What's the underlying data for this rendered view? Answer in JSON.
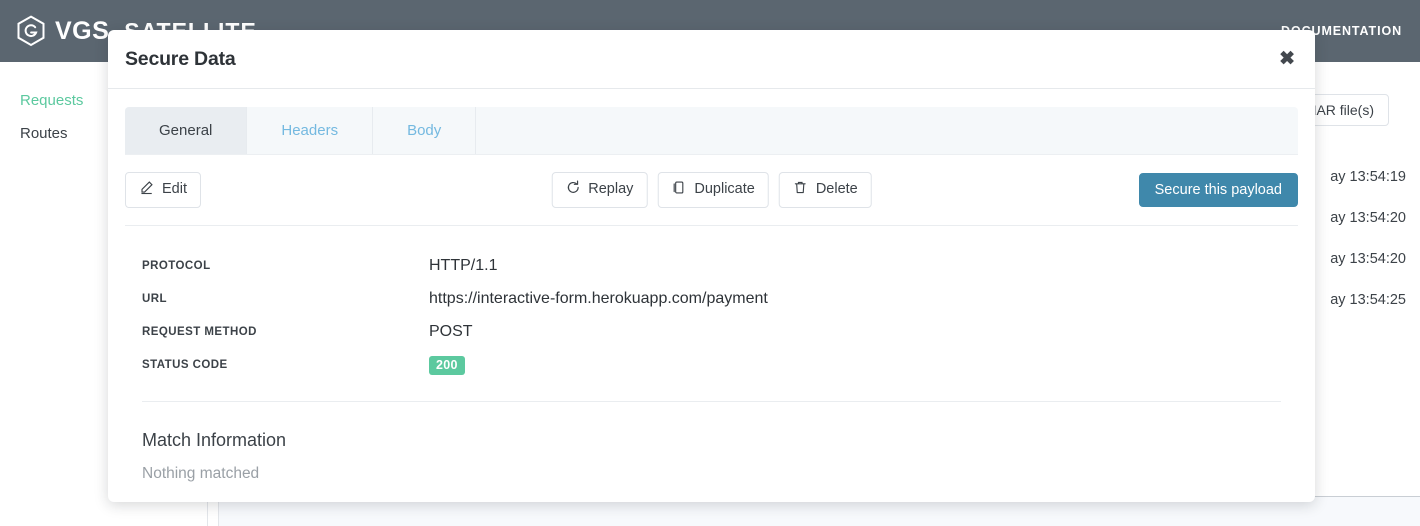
{
  "topbar": {
    "brand_mark": "vgs-hex-logo",
    "brand_name": "VGS",
    "product_name": "SATELLITE",
    "nav": [
      {
        "label": "DOCUMENTATION",
        "name": "documentation"
      }
    ]
  },
  "sidebar": {
    "items": [
      {
        "label": "Requests",
        "active": true
      },
      {
        "label": "Routes",
        "active": false
      }
    ]
  },
  "content": {
    "toolbar": {
      "har_button_label": "HAR file(s)"
    },
    "request_rows": [
      {
        "timestamp": "ay 13:54:19"
      },
      {
        "timestamp": "ay 13:54:20"
      },
      {
        "timestamp": "ay 13:54:20"
      },
      {
        "timestamp": "ay 13:54:25"
      }
    ]
  },
  "modal": {
    "title": "Secure Data",
    "close_label": "✖",
    "tabs": [
      {
        "label": "General",
        "active": true
      },
      {
        "label": "Headers",
        "active": false
      },
      {
        "label": "Body",
        "active": false
      }
    ],
    "actions": {
      "edit_label": "Edit",
      "replay_label": "Replay",
      "duplicate_label": "Duplicate",
      "delete_label": "Delete",
      "primary_label": "Secure this payload"
    },
    "details": [
      {
        "label": "PROTOCOL",
        "value": "HTTP/1.1",
        "type": "text"
      },
      {
        "label": "URL",
        "value": "https://interactive-form.herokuapp.com/payment",
        "type": "text"
      },
      {
        "label": "REQUEST METHOD",
        "value": "POST",
        "type": "text"
      },
      {
        "label": "STATUS CODE",
        "value": "200",
        "type": "badge"
      }
    ],
    "match": {
      "title": "Match Information",
      "text": "Nothing matched"
    }
  },
  "colors": {
    "header_bar": "#5b6670",
    "accent_green": "#5cc99f",
    "primary_blue": "#3f88ab",
    "tab_link_blue": "#74b9e0",
    "muted_text": "#9aa0a6"
  }
}
